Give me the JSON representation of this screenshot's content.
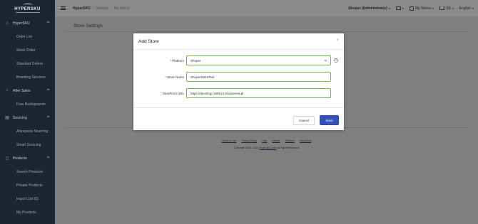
{
  "brand": {
    "logo_text": "HYPERSKU"
  },
  "sidebar": {
    "items": [
      {
        "label": "HyperSKU",
        "type": "section",
        "icon": "home-icon"
      },
      {
        "label": "Order List",
        "type": "item"
      },
      {
        "label": "Stock Order",
        "type": "item"
      },
      {
        "label": "Standard Orders",
        "type": "item"
      },
      {
        "label": "Branding Services",
        "type": "item"
      },
      {
        "label": "After Sales",
        "type": "section",
        "icon": "lightbulb-icon"
      },
      {
        "label": "Free Reshipments",
        "type": "item"
      },
      {
        "label": "Sourcing",
        "type": "section",
        "icon": "sourcing-icon"
      },
      {
        "label": "Aliexpress Sourcing",
        "type": "item"
      },
      {
        "label": "Smart Sourcing",
        "type": "item"
      },
      {
        "label": "Products",
        "type": "section",
        "icon": "bag-icon"
      },
      {
        "label": "Search Products",
        "type": "item"
      },
      {
        "label": "Private Products",
        "type": "item"
      },
      {
        "label": "Import List (0)",
        "type": "item"
      },
      {
        "label": "My Products",
        "type": "item"
      }
    ]
  },
  "header": {
    "breadcrumb": {
      "root": "HyperSKU",
      "sep": "/",
      "settings": "Settings",
      "current": "My Stores"
    },
    "user": "Shoper (Administrator)",
    "stores_label": "My Stores",
    "cart_count": "(0)",
    "language": "English"
  },
  "page": {
    "title": "Store Settings"
  },
  "footer": {
    "links": [
      "Terms of Use",
      "Privacy Policy",
      "Help",
      "Affiliate",
      "Partners",
      "HyperBlog"
    ],
    "copyright_prefix": "Copyright 2018 - 2021",
    "copyright_link": "HyperSKU.com",
    "copyright_suffix": "All Rights Reserved"
  },
  "modal": {
    "title": "Add Store",
    "close": "×",
    "platform_label": "Platform",
    "platform_value": "Shoper",
    "store_name_label": "Store Name",
    "store_name_value": "ShoperStoreTest",
    "storefront_label": "Storefront URL",
    "storefront_value": "https://devshop-158514.shoparena.pl",
    "required_mark": "*",
    "help": "?",
    "cancel_label": "Cancel",
    "save_label": "Save"
  },
  "colors": {
    "sidebar_bg": "#1c2533",
    "primary": "#3452b8",
    "field_border": "#6fbf43",
    "required": "#e04040"
  }
}
